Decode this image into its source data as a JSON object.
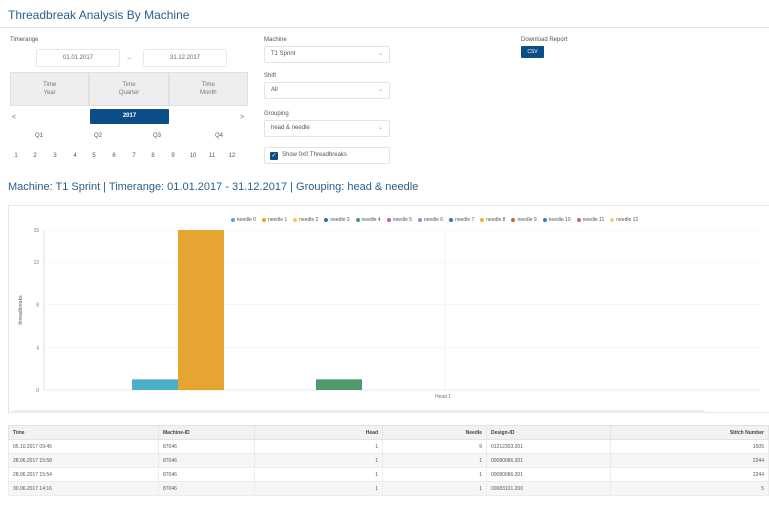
{
  "page": {
    "title": "Threadbreak Analysis By Machine"
  },
  "timerange": {
    "label": "Timerange",
    "from": "01.01.2017",
    "arrow": "→",
    "to": "31.12.2017",
    "timeframes": [
      "Time\nYear",
      "Time\nQuarter",
      "Time\nMonth"
    ],
    "prev": "<",
    "year": "2017",
    "next": ">",
    "quarters": [
      "Q1",
      "Q2",
      "Q3",
      "Q4"
    ],
    "months": [
      "1",
      "2",
      "3",
      "4",
      "5",
      "6",
      "7",
      "8",
      "9",
      "10",
      "11",
      "12"
    ]
  },
  "filters": {
    "machine_label": "Machine",
    "machine_value": "T1 Sprint",
    "shift_label": "Shift",
    "shift_value": "All",
    "grouping_label": "Grouping",
    "grouping_value": "head & needle",
    "show_label": "Show 0x0 Threadbreaks"
  },
  "download": {
    "label": "Download Report",
    "button": "CSV"
  },
  "section_title": "Machine: T1 Sprint | Timerange: 01.01.2017 - 31.12.2017 | Grouping: head & needle",
  "chart_data": {
    "type": "bar",
    "categories": [
      "Head 1"
    ],
    "ylabel": "threadbreaks",
    "ylim": [
      0,
      15
    ],
    "y_ticks": [
      "0",
      "4",
      "8",
      "12",
      "15"
    ],
    "legend_position": "top",
    "series": [
      {
        "name": "needle 0",
        "color": "#4ab0c8",
        "values": [
          1
        ]
      },
      {
        "name": "needle 1",
        "color": "#e6a531",
        "values": [
          15
        ]
      },
      {
        "name": "needle 2",
        "color": "#f0d04a",
        "values": [
          0
        ]
      },
      {
        "name": "needle 3",
        "color": "#2f6fa8",
        "values": [
          0
        ]
      },
      {
        "name": "needle 4",
        "color": "#4e9a6c",
        "values": [
          1
        ]
      },
      {
        "name": "needle 5",
        "color": "#c064b0",
        "values": [
          0
        ]
      },
      {
        "name": "needle 6",
        "color": "#a086c8",
        "values": [
          0
        ]
      },
      {
        "name": "needle 7",
        "color": "#4b68c8",
        "values": [
          0
        ]
      },
      {
        "name": "needle 8",
        "color": "#e8b838",
        "values": [
          0
        ]
      },
      {
        "name": "needle 9",
        "color": "#e05a2a",
        "values": [
          0
        ]
      },
      {
        "name": "needle 10",
        "color": "#3a7fc0",
        "values": [
          0
        ]
      },
      {
        "name": "needle 11",
        "color": "#d45a9a",
        "values": [
          0
        ]
      },
      {
        "name": "needle 12",
        "color": "#f0d85a",
        "values": [
          0
        ]
      }
    ]
  },
  "table": {
    "columns": [
      "Time",
      "Machine-ID",
      "Head",
      "Needle",
      "Design-ID",
      "Stitch Number"
    ],
    "rows": [
      [
        "05.10.2017 09:45",
        "87046",
        "1",
        "9",
        "01212303.201",
        "1505"
      ],
      [
        "28.06.2017 15:58",
        "87046",
        "1",
        "1",
        "00080086.201",
        "2244"
      ],
      [
        "28.06.2017 15:54",
        "87046",
        "1",
        "1",
        "00080086.201",
        "2244"
      ],
      [
        "30.06.2017 14:16",
        "87046",
        "1",
        "1",
        "00083101.200",
        "5"
      ]
    ]
  }
}
